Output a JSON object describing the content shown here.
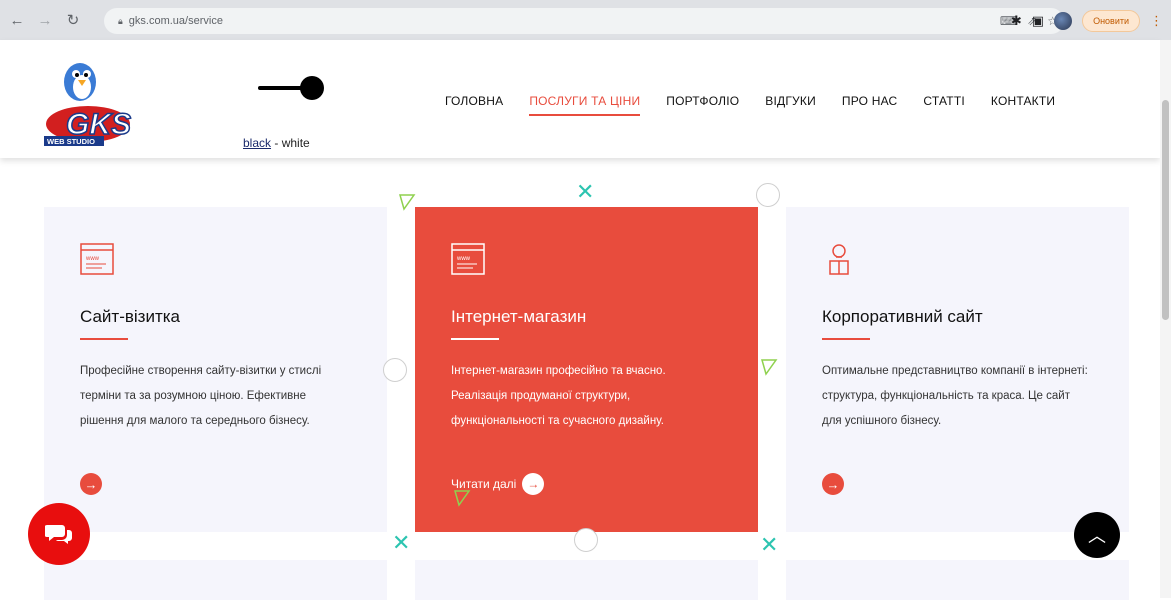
{
  "browser": {
    "url": "gks.com.ua/service",
    "update_label": "Оновити"
  },
  "header": {
    "logo_text": "GKS",
    "logo_sub": "WEB STUDIO",
    "theme_toggle": {
      "black": "black",
      "separator": " - ",
      "white": "white"
    },
    "nav": [
      {
        "label": "ГОЛОВНА",
        "active": false
      },
      {
        "label": "ПОСЛУГИ ТА ЦІНИ",
        "active": true
      },
      {
        "label": "ПОРТФОЛІО",
        "active": false
      },
      {
        "label": "ВІДГУКИ",
        "active": false
      },
      {
        "label": "ПРО НАС",
        "active": false
      },
      {
        "label": "СТАТТІ",
        "active": false
      },
      {
        "label": "КОНТАКТИ",
        "active": false
      }
    ]
  },
  "cards": [
    {
      "icon": "browser-window-icon",
      "title": "Сайт-візитка",
      "description": "Професійне створення сайту-візитки у стислі терміни та за розумною ціною. Ефективне рішення для малого та середнього бізнесу."
    },
    {
      "icon": "browser-window-icon",
      "title": "Інтернет-магазин",
      "description": "Інтернет-магазин професійно та вчасно. Реалізація продуманої структури, функціональності та сучасного дизайну.",
      "read_more": "Читати далі"
    },
    {
      "icon": "idea-box-icon",
      "title": "Корпоративний сайт",
      "description": "Оптимальне представництво компанії в інтернеті: структура, функціональність та краса. Це сайт для успішного бізнесу."
    }
  ],
  "colors": {
    "accent": "#e84c3d",
    "card_bg": "#f5f5fc",
    "deco_teal": "#2cc4b0",
    "chat": "#e80e0e"
  }
}
